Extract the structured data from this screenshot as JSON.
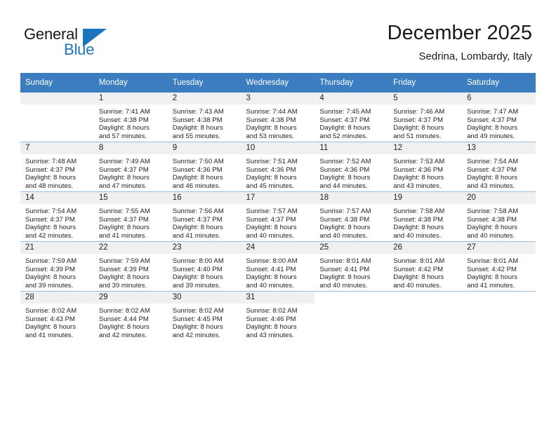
{
  "brand": {
    "name_part1": "General",
    "name_part2": "Blue",
    "flag_icon": "flag-icon"
  },
  "header": {
    "title": "December 2025",
    "subtitle": "Sedrina, Lombardy, Italy"
  },
  "calendar": {
    "accent_color": "#3b7dc0",
    "daynum_bg": "#f0f0f0",
    "weekday_headers": [
      "Sunday",
      "Monday",
      "Tuesday",
      "Wednesday",
      "Thursday",
      "Friday",
      "Saturday"
    ],
    "weeks": [
      [
        {
          "day": "",
          "lines": []
        },
        {
          "day": "1",
          "lines": [
            "Sunrise: 7:41 AM",
            "Sunset: 4:38 PM",
            "Daylight: 8 hours",
            "and 57 minutes."
          ]
        },
        {
          "day": "2",
          "lines": [
            "Sunrise: 7:43 AM",
            "Sunset: 4:38 PM",
            "Daylight: 8 hours",
            "and 55 minutes."
          ]
        },
        {
          "day": "3",
          "lines": [
            "Sunrise: 7:44 AM",
            "Sunset: 4:38 PM",
            "Daylight: 8 hours",
            "and 53 minutes."
          ]
        },
        {
          "day": "4",
          "lines": [
            "Sunrise: 7:45 AM",
            "Sunset: 4:37 PM",
            "Daylight: 8 hours",
            "and 52 minutes."
          ]
        },
        {
          "day": "5",
          "lines": [
            "Sunrise: 7:46 AM",
            "Sunset: 4:37 PM",
            "Daylight: 8 hours",
            "and 51 minutes."
          ]
        },
        {
          "day": "6",
          "lines": [
            "Sunrise: 7:47 AM",
            "Sunset: 4:37 PM",
            "Daylight: 8 hours",
            "and 49 minutes."
          ]
        }
      ],
      [
        {
          "day": "7",
          "lines": [
            "Sunrise: 7:48 AM",
            "Sunset: 4:37 PM",
            "Daylight: 8 hours",
            "and 48 minutes."
          ]
        },
        {
          "day": "8",
          "lines": [
            "Sunrise: 7:49 AM",
            "Sunset: 4:37 PM",
            "Daylight: 8 hours",
            "and 47 minutes."
          ]
        },
        {
          "day": "9",
          "lines": [
            "Sunrise: 7:50 AM",
            "Sunset: 4:36 PM",
            "Daylight: 8 hours",
            "and 46 minutes."
          ]
        },
        {
          "day": "10",
          "lines": [
            "Sunrise: 7:51 AM",
            "Sunset: 4:36 PM",
            "Daylight: 8 hours",
            "and 45 minutes."
          ]
        },
        {
          "day": "11",
          "lines": [
            "Sunrise: 7:52 AM",
            "Sunset: 4:36 PM",
            "Daylight: 8 hours",
            "and 44 minutes."
          ]
        },
        {
          "day": "12",
          "lines": [
            "Sunrise: 7:53 AM",
            "Sunset: 4:36 PM",
            "Daylight: 8 hours",
            "and 43 minutes."
          ]
        },
        {
          "day": "13",
          "lines": [
            "Sunrise: 7:54 AM",
            "Sunset: 4:37 PM",
            "Daylight: 8 hours",
            "and 43 minutes."
          ]
        }
      ],
      [
        {
          "day": "14",
          "lines": [
            "Sunrise: 7:54 AM",
            "Sunset: 4:37 PM",
            "Daylight: 8 hours",
            "and 42 minutes."
          ]
        },
        {
          "day": "15",
          "lines": [
            "Sunrise: 7:55 AM",
            "Sunset: 4:37 PM",
            "Daylight: 8 hours",
            "and 41 minutes."
          ]
        },
        {
          "day": "16",
          "lines": [
            "Sunrise: 7:56 AM",
            "Sunset: 4:37 PM",
            "Daylight: 8 hours",
            "and 41 minutes."
          ]
        },
        {
          "day": "17",
          "lines": [
            "Sunrise: 7:57 AM",
            "Sunset: 4:37 PM",
            "Daylight: 8 hours",
            "and 40 minutes."
          ]
        },
        {
          "day": "18",
          "lines": [
            "Sunrise: 7:57 AM",
            "Sunset: 4:38 PM",
            "Daylight: 8 hours",
            "and 40 minutes."
          ]
        },
        {
          "day": "19",
          "lines": [
            "Sunrise: 7:58 AM",
            "Sunset: 4:38 PM",
            "Daylight: 8 hours",
            "and 40 minutes."
          ]
        },
        {
          "day": "20",
          "lines": [
            "Sunrise: 7:58 AM",
            "Sunset: 4:38 PM",
            "Daylight: 8 hours",
            "and 40 minutes."
          ]
        }
      ],
      [
        {
          "day": "21",
          "lines": [
            "Sunrise: 7:59 AM",
            "Sunset: 4:39 PM",
            "Daylight: 8 hours",
            "and 39 minutes."
          ]
        },
        {
          "day": "22",
          "lines": [
            "Sunrise: 7:59 AM",
            "Sunset: 4:39 PM",
            "Daylight: 8 hours",
            "and 39 minutes."
          ]
        },
        {
          "day": "23",
          "lines": [
            "Sunrise: 8:00 AM",
            "Sunset: 4:40 PM",
            "Daylight: 8 hours",
            "and 39 minutes."
          ]
        },
        {
          "day": "24",
          "lines": [
            "Sunrise: 8:00 AM",
            "Sunset: 4:41 PM",
            "Daylight: 8 hours",
            "and 40 minutes."
          ]
        },
        {
          "day": "25",
          "lines": [
            "Sunrise: 8:01 AM",
            "Sunset: 4:41 PM",
            "Daylight: 8 hours",
            "and 40 minutes."
          ]
        },
        {
          "day": "26",
          "lines": [
            "Sunrise: 8:01 AM",
            "Sunset: 4:42 PM",
            "Daylight: 8 hours",
            "and 40 minutes."
          ]
        },
        {
          "day": "27",
          "lines": [
            "Sunrise: 8:01 AM",
            "Sunset: 4:42 PM",
            "Daylight: 8 hours",
            "and 41 minutes."
          ]
        }
      ],
      [
        {
          "day": "28",
          "lines": [
            "Sunrise: 8:02 AM",
            "Sunset: 4:43 PM",
            "Daylight: 8 hours",
            "and 41 minutes."
          ]
        },
        {
          "day": "29",
          "lines": [
            "Sunrise: 8:02 AM",
            "Sunset: 4:44 PM",
            "Daylight: 8 hours",
            "and 42 minutes."
          ]
        },
        {
          "day": "30",
          "lines": [
            "Sunrise: 8:02 AM",
            "Sunset: 4:45 PM",
            "Daylight: 8 hours",
            "and 42 minutes."
          ]
        },
        {
          "day": "31",
          "lines": [
            "Sunrise: 8:02 AM",
            "Sunset: 4:46 PM",
            "Daylight: 8 hours",
            "and 43 minutes."
          ]
        },
        {
          "day": "",
          "lines": []
        },
        {
          "day": "",
          "lines": []
        },
        {
          "day": "",
          "lines": []
        }
      ]
    ]
  }
}
